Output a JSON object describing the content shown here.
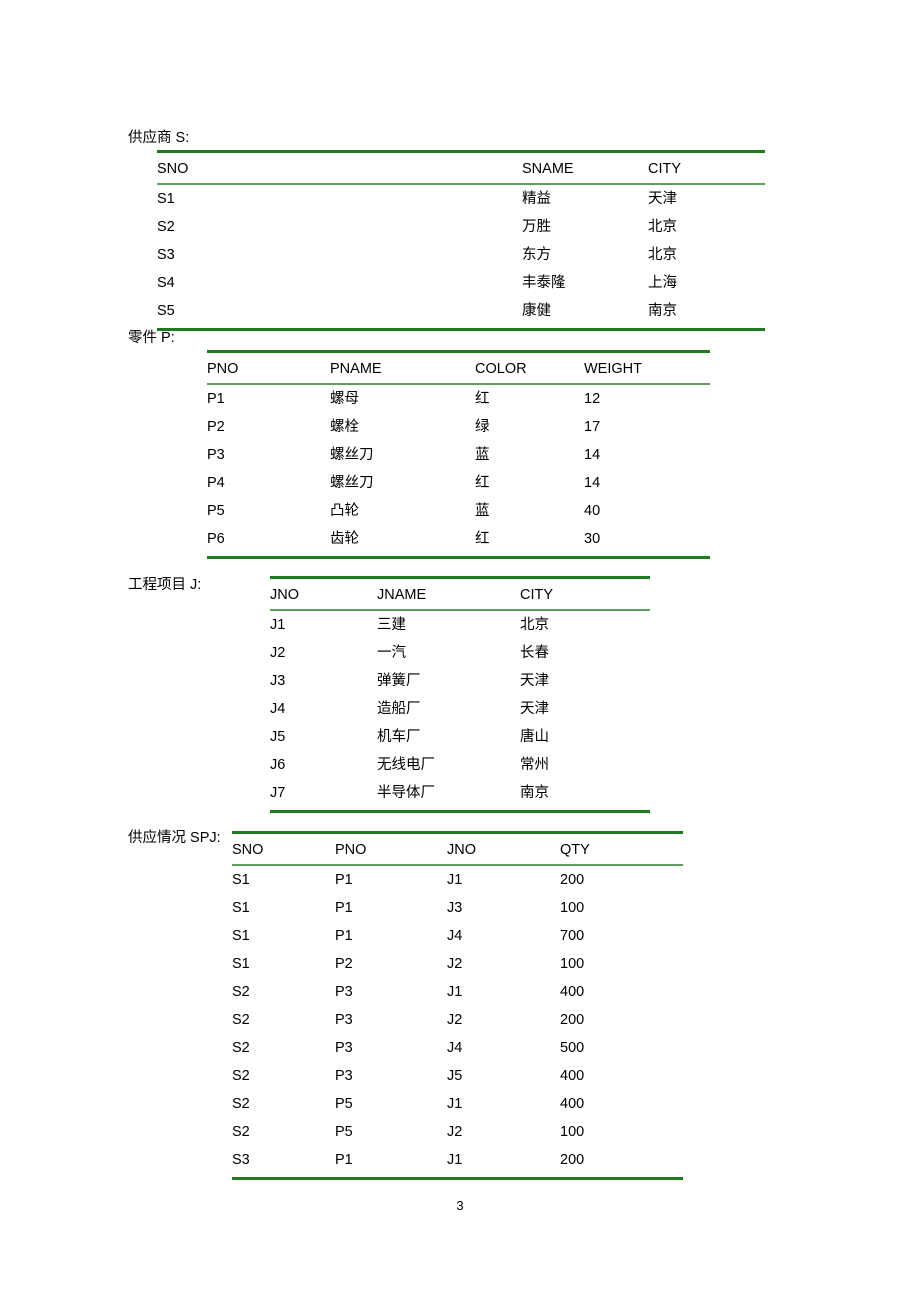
{
  "document": {
    "page_number": "3",
    "accent_color": "#1f7a1f",
    "header_rule_color": "#5f9e5f"
  },
  "tables": [
    {
      "caption": "供应商 S:",
      "name": "supplier-table",
      "columns": [
        "SNO",
        "SNAME",
        "CITY"
      ],
      "rows": [
        [
          "S1",
          "精益",
          "天津"
        ],
        [
          "S2",
          "万胜",
          "北京"
        ],
        [
          "S3",
          "东方",
          "北京"
        ],
        [
          "S4",
          "丰泰隆",
          "上海"
        ],
        [
          "S5",
          "康健",
          "南京"
        ]
      ]
    },
    {
      "caption": "零件 P:",
      "name": "part-table",
      "columns": [
        "PNO",
        "PNAME",
        "COLOR",
        "WEIGHT"
      ],
      "rows": [
        [
          "P1",
          "螺母",
          "红",
          "12"
        ],
        [
          "P2",
          "螺栓",
          "绿",
          "17"
        ],
        [
          "P3",
          "螺丝刀",
          "蓝",
          "14"
        ],
        [
          "P4",
          "螺丝刀",
          "红",
          "14"
        ],
        [
          "P5",
          "凸轮",
          "蓝",
          "40"
        ],
        [
          "P6",
          "齿轮",
          "红",
          "30"
        ]
      ]
    },
    {
      "caption": "工程项目 J:",
      "name": "project-table",
      "columns": [
        "JNO",
        "JNAME",
        "CITY"
      ],
      "rows": [
        [
          "J1",
          "三建",
          "北京"
        ],
        [
          "J2",
          "一汽",
          "长春"
        ],
        [
          "J3",
          "弹簧厂",
          "天津"
        ],
        [
          "J4",
          "造船厂",
          "天津"
        ],
        [
          "J5",
          "机车厂",
          "唐山"
        ],
        [
          "J6",
          "无线电厂",
          "常州"
        ],
        [
          "J7",
          "半导体厂",
          "南京"
        ]
      ]
    },
    {
      "caption": "供应情况 SPJ:",
      "name": "supply-table",
      "columns": [
        "SNO",
        "PNO",
        "JNO",
        "QTY"
      ],
      "rows": [
        [
          "S1",
          "P1",
          "J1",
          "200"
        ],
        [
          "S1",
          "P1",
          "J3",
          "100"
        ],
        [
          "S1",
          "P1",
          "J4",
          "700"
        ],
        [
          "S1",
          "P2",
          "J2",
          "100"
        ],
        [
          "S2",
          "P3",
          "J1",
          "400"
        ],
        [
          "S2",
          "P3",
          "J2",
          "200"
        ],
        [
          "S2",
          "P3",
          "J4",
          "500"
        ],
        [
          "S2",
          "P3",
          "J5",
          "400"
        ],
        [
          "S2",
          "P5",
          "J1",
          "400"
        ],
        [
          "S2",
          "P5",
          "J2",
          "100"
        ],
        [
          "S3",
          "P1",
          "J1",
          "200"
        ]
      ]
    }
  ]
}
